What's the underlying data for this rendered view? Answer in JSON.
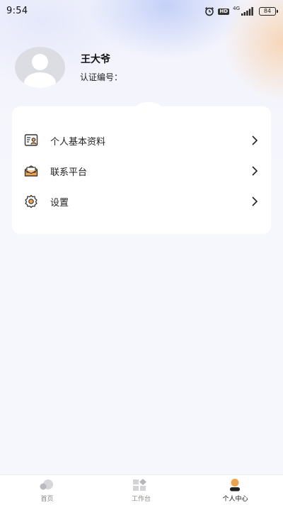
{
  "status_bar": {
    "time": "9:54",
    "network": "4G",
    "hd": "HD",
    "battery": "84"
  },
  "profile": {
    "name": "王大爷",
    "id_label": "认证编号："
  },
  "menu": [
    {
      "label": "个人基本资料",
      "icon": "profile-card-icon"
    },
    {
      "label": "联系平台",
      "icon": "mail-icon"
    },
    {
      "label": "设置",
      "icon": "gear-icon"
    }
  ],
  "tabbar": {
    "items": [
      {
        "label": "首页",
        "icon": "home-icon",
        "active": false
      },
      {
        "label": "工作台",
        "icon": "workbench-icon",
        "active": false
      },
      {
        "label": "个人中心",
        "icon": "person-icon",
        "active": true
      }
    ]
  },
  "colors": {
    "accent": "#f0a34a",
    "page_bg": "#f6f6fd",
    "card_bg": "#ffffff",
    "tab_inactive": "#c9c9cf"
  }
}
